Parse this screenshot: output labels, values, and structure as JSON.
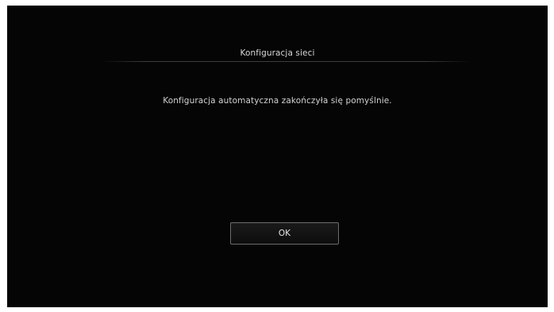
{
  "dialog": {
    "title": "Konfiguracja sieci",
    "message": "Konfiguracja automatyczna zakończyła się pomyślnie.",
    "ok_label": "OK"
  },
  "colors": {
    "background": "#050505",
    "text": "#dcdcdc",
    "button_border": "#6b6b6b"
  }
}
